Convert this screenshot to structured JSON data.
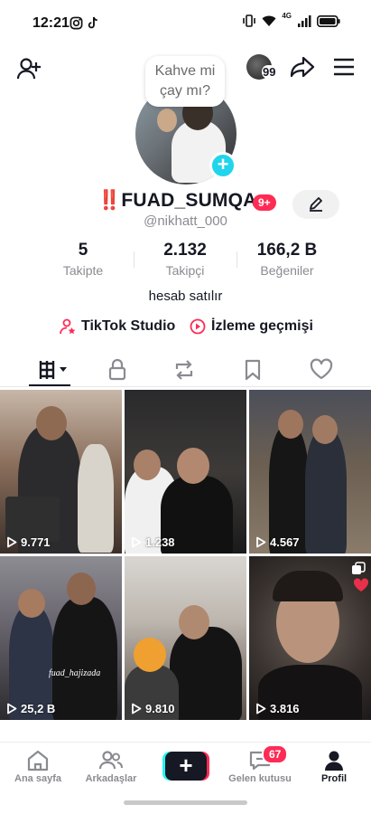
{
  "status_bar": {
    "time": "12:21",
    "network": "4G"
  },
  "top_bar": {
    "friends_count": "99"
  },
  "profile": {
    "bubble_text": "Kahve mi çay mı?",
    "name_prefix": "‼️",
    "display_name": "FUAD_SUMQA...",
    "notification_badge": "9+",
    "handle": "@nikhatt_000",
    "bio": "hesab satılır"
  },
  "stats": [
    {
      "value": "5",
      "label": "Takipte"
    },
    {
      "value": "2.132",
      "label": "Takipçi"
    },
    {
      "value": "166,2 B",
      "label": "Beğeniler"
    }
  ],
  "links": {
    "studio": "TikTok Studio",
    "history": "İzleme geçmişi"
  },
  "tabs": [
    "videos-tab",
    "private-tab",
    "reposts-tab",
    "favorites-tab",
    "liked-tab"
  ],
  "videos": [
    {
      "views": "9.771"
    },
    {
      "views": "1.238"
    },
    {
      "views": "4.567"
    },
    {
      "views": "25,2 B",
      "caption": "fuad_hajizada"
    },
    {
      "views": "9.810"
    },
    {
      "views": "3.816"
    }
  ],
  "bottom_nav": {
    "home": "Ana sayfa",
    "friends": "Arkadaşlar",
    "inbox": "Gelen kutusu",
    "inbox_badge": "67",
    "profile": "Profil"
  },
  "colors": {
    "accent": "#fe2c55",
    "cyan": "#20d5ec",
    "text": "#161823",
    "muted": "#8a8b91"
  }
}
